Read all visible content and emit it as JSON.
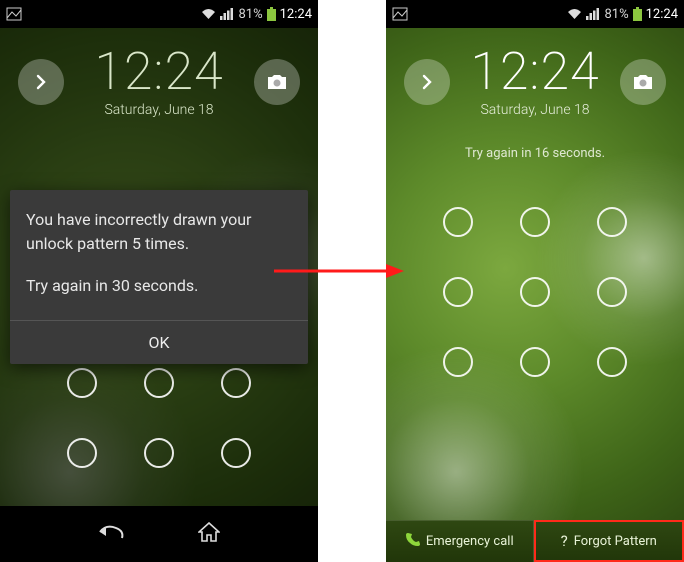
{
  "status": {
    "battery_pct": "81%",
    "clock": "12:24"
  },
  "lockscreen": {
    "time": "12:24",
    "date": "Saturday, June 18",
    "retry_left_seconds": 16,
    "try_again_right": "Try again in 16 seconds."
  },
  "dialog": {
    "line1": "You have incorrectly drawn your unlock pattern 5 times.",
    "line2": "Try again in 30 seconds.",
    "ok": "OK"
  },
  "bottom": {
    "emergency": "Emergency call",
    "forgot": "Forgot Pattern"
  }
}
